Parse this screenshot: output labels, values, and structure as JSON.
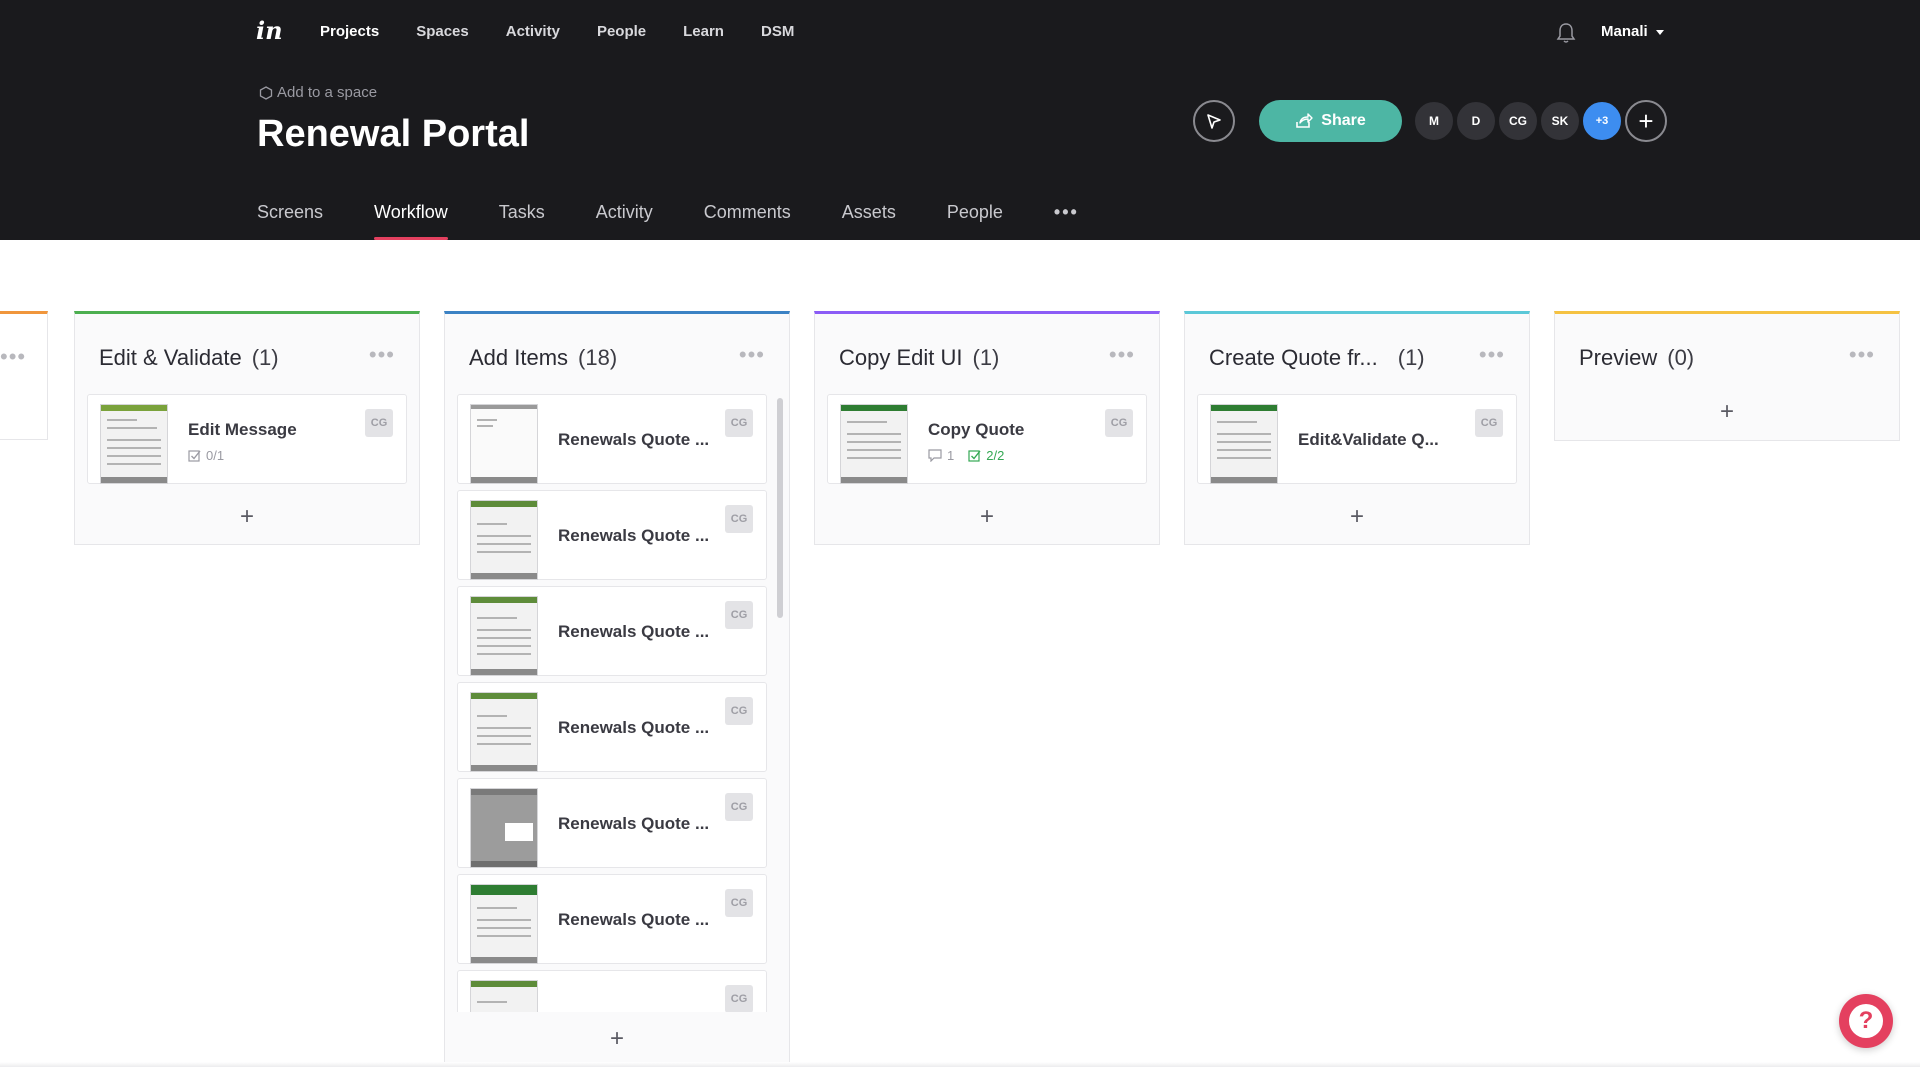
{
  "header": {
    "logo": "in",
    "nav": [
      "Projects",
      "Spaces",
      "Activity",
      "People",
      "Learn",
      "DSM"
    ],
    "active_nav": "Projects",
    "user": "Manali",
    "add_to_space": "Add to a space",
    "project_title": "Renewal Portal",
    "share_label": "Share",
    "avatars": [
      "M",
      "D",
      "CG",
      "SK",
      "+3"
    ],
    "accent_color": "#4db6a4"
  },
  "tabs": {
    "items": [
      "Screens",
      "Workflow",
      "Tasks",
      "Activity",
      "Comments",
      "Assets",
      "People"
    ],
    "active": "Workflow",
    "more": "•••"
  },
  "columns": [
    {
      "title": "Edit & Validate",
      "count": "(1)",
      "color": "#4caf50",
      "cards": [
        {
          "title": "Edit Message",
          "initials": "CG",
          "tasks": "0/1"
        }
      ]
    },
    {
      "title": "Add Items",
      "count": "(18)",
      "color": "#3b82c4",
      "cards": [
        {
          "title": "Renewals Quote ...",
          "initials": "CG"
        },
        {
          "title": "Renewals Quote ...",
          "initials": "CG"
        },
        {
          "title": "Renewals Quote ...",
          "initials": "CG"
        },
        {
          "title": "Renewals Quote ...",
          "initials": "CG"
        },
        {
          "title": "Renewals Quote ...",
          "initials": "CG"
        },
        {
          "title": "Renewals Quote ...",
          "initials": "CG"
        },
        {
          "title": "",
          "initials": "CG"
        }
      ]
    },
    {
      "title": "Copy Edit UI",
      "count": "(1)",
      "color": "#8b5cf6",
      "cards": [
        {
          "title": "Copy Quote",
          "initials": "CG",
          "comments": "1",
          "tasks": "2/2"
        }
      ]
    },
    {
      "title": "Create Quote fr...",
      "count": "(1)",
      "color": "#5bc8d8",
      "cards": [
        {
          "title": "Edit&Validate Q...",
          "initials": "CG"
        }
      ]
    },
    {
      "title": "Preview",
      "count": "(0)",
      "color": "#f5c242",
      "cards": []
    }
  ],
  "partial_column_color": "#f0963c",
  "add_symbol": "+",
  "menu_symbol": "•••",
  "help_symbol": "?"
}
